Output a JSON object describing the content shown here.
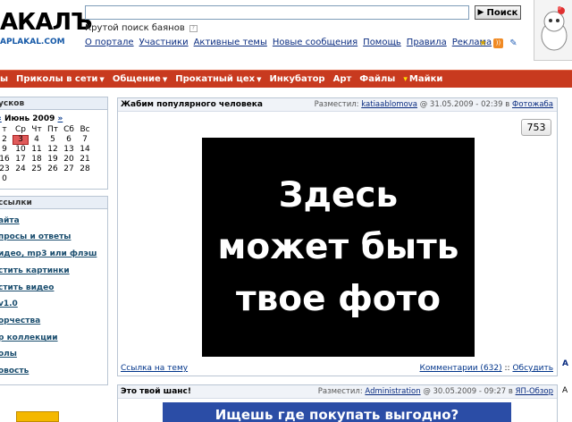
{
  "header": {
    "logo_main": "АКАЛЪ",
    "logo_sub": "APLAKAL.COM",
    "search_placeholder": "",
    "search_button": "Поиск",
    "search_hint": "Крутой поиск баянов",
    "top_links": [
      "О портале",
      "Участники",
      "Активные темы",
      "Новые сообщения",
      "Помощь",
      "Правила",
      "Реклама"
    ]
  },
  "nav": {
    "items": [
      {
        "label": "ы",
        "caret": false
      },
      {
        "label": "Приколы в сети",
        "caret": true
      },
      {
        "label": "Общение",
        "caret": true
      },
      {
        "label": "Прокатный цех",
        "caret": true
      },
      {
        "label": "Инкубатор",
        "caret": false
      },
      {
        "label": "Арт",
        "caret": false
      },
      {
        "label": "Файлы",
        "caret": false
      },
      {
        "label": "Майки",
        "caret": false
      }
    ]
  },
  "calendar": {
    "head": "усков",
    "prev": "«",
    "month": "Июнь 2009",
    "next": "»",
    "weekdays": [
      "т",
      "Ср",
      "Чт",
      "Пт",
      "Сб",
      "Вс"
    ],
    "rows": [
      [
        "2",
        "3",
        "4",
        "5",
        "6",
        "7"
      ],
      [
        "9",
        "10",
        "11",
        "12",
        "13",
        "14"
      ],
      [
        "16",
        "17",
        "18",
        "19",
        "20",
        "21"
      ],
      [
        "23",
        "24",
        "25",
        "26",
        "27",
        "28"
      ],
      [
        "0",
        "",
        "",
        "",
        "",
        ""
      ]
    ],
    "today": "3"
  },
  "side_links": {
    "head": "ссылки",
    "items": [
      "айта",
      "просы и ответы",
      "идео, mp3 или флэш",
      "стить картинки",
      "стить видео",
      "v1.0",
      "орчества",
      "р коллекции",
      "олы",
      "овость"
    ]
  },
  "post": {
    "title": "Жабим популярного человека",
    "posted_label": "Разместил:",
    "author": "katiaablomova",
    "date": "@ 31.05.2009 - 02:39 в",
    "category": "Фотожаба",
    "rating": "753",
    "photo_lines": [
      "Здесь",
      "может быть",
      "твое фото"
    ],
    "link_label": "Ссылка на тему",
    "comments_label": "Комментарии (632)",
    "discuss_label": "Обсудить"
  },
  "post2": {
    "title": "Это твой шанс!",
    "posted_label": "Разместил:",
    "author": "Administration",
    "date": "@ 30.05.2009 - 09:27 в",
    "category": "ЯП-Обзор",
    "banner_text": "Ищешь где покупать выгодно?"
  },
  "right_strip": {
    "a": "А",
    "b": "А"
  }
}
